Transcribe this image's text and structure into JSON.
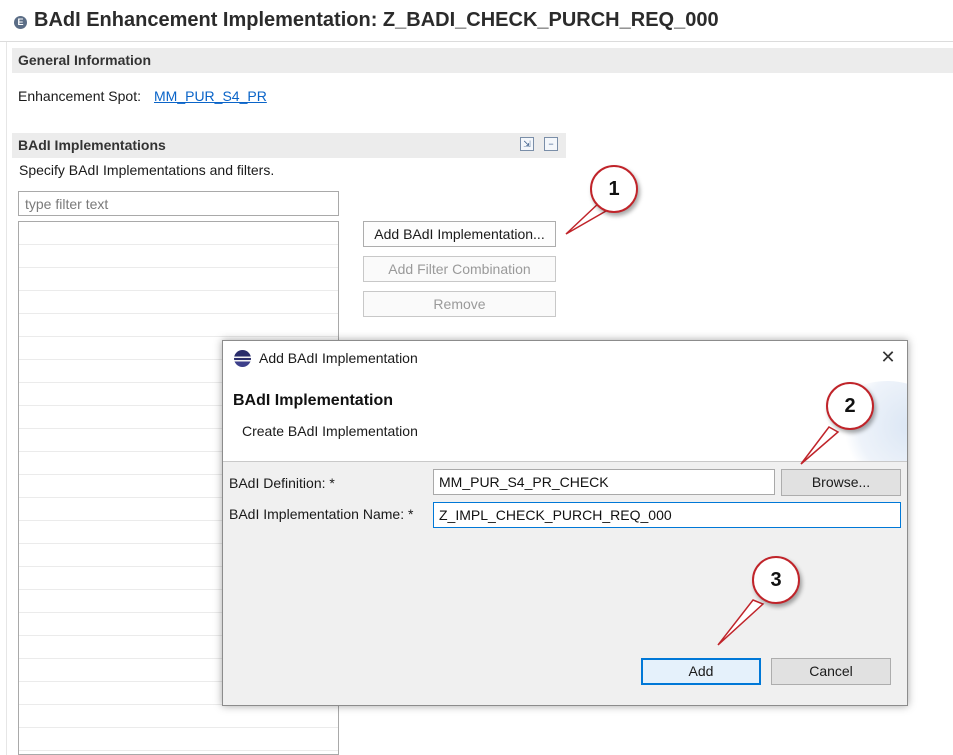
{
  "editor": {
    "title": "BAdI Enhancement Implementation: Z_BADI_CHECK_PURCH_REQ_000",
    "title_icon": "E",
    "general": {
      "heading": "General Information",
      "spot_label": "Enhancement Spot:",
      "spot_value": "MM_PUR_S4_PR"
    },
    "implementations": {
      "heading": "BAdI Implementations",
      "description": "Specify BAdI Implementations and filters.",
      "filter_placeholder": "type filter text",
      "icons": [
        "expand-all-icon",
        "collapse-all-icon"
      ],
      "buttons": {
        "add": "Add BAdI Implementation...",
        "add_filter": "Add Filter Combination",
        "remove": "Remove"
      }
    }
  },
  "dialog": {
    "title": "Add BAdI Implementation",
    "heading": "BAdI Implementation",
    "subtitle": "Create BAdI Implementation",
    "definition_label": "BAdI Definition: *",
    "definition_value": "MM_PUR_S4_PR_CHECK",
    "browse_label": "Browse...",
    "name_label": "BAdI Implementation Name: *",
    "name_value": "Z_IMPL_CHECK_PURCH_REQ_000",
    "add_label": "Add",
    "cancel_label": "Cancel",
    "close_glyph": "✕"
  },
  "callouts": [
    "1",
    "2",
    "3"
  ],
  "colors": {
    "link": "#0a64c8",
    "callout_border": "#c0242a",
    "focus": "#0078d7"
  }
}
